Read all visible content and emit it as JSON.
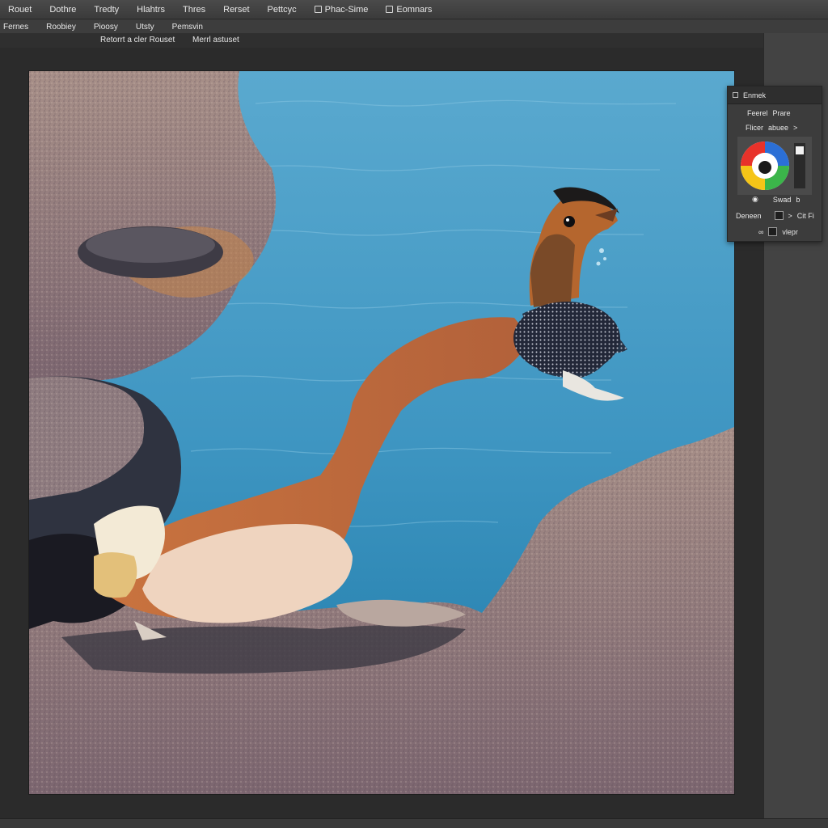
{
  "menu": {
    "items": [
      {
        "label": "Rouet"
      },
      {
        "label": "Dothre"
      },
      {
        "label": "Tredty"
      },
      {
        "label": "Hlahtrs"
      },
      {
        "label": "Thres"
      },
      {
        "label": "Rerset"
      },
      {
        "label": "Pettcyc"
      },
      {
        "label": "Phac-Sime",
        "icon": "square-icon"
      },
      {
        "label": "Eomnars",
        "icon": "square-icon"
      }
    ]
  },
  "options_bar": {
    "items": [
      "Fernes",
      "Roobiey",
      "Pioosy",
      "Utsty",
      "Pemsvin"
    ]
  },
  "doc_tabs": {
    "tab1": "Retorrt a cler Rouset",
    "tab2": "Merrl astuset"
  },
  "panel": {
    "title": "Enmek",
    "row1": [
      "Feerel",
      "Prare"
    ],
    "row2": [
      "Flicer",
      "abuee"
    ],
    "row2_chevron": ">",
    "row3_label": "Swad",
    "row3_mark": "b",
    "row4_left": "Deneen",
    "row4_chevron": ">",
    "row4_right": "Cit Fi",
    "row5_label": "vlepr",
    "colors": {
      "wheel_red": "#e8322a",
      "wheel_green": "#3bb54a",
      "wheel_blue": "#2b6fd6",
      "wheel_yellow": "#f5c518"
    }
  },
  "canvas_image": {
    "description_icon": "photo-image"
  }
}
